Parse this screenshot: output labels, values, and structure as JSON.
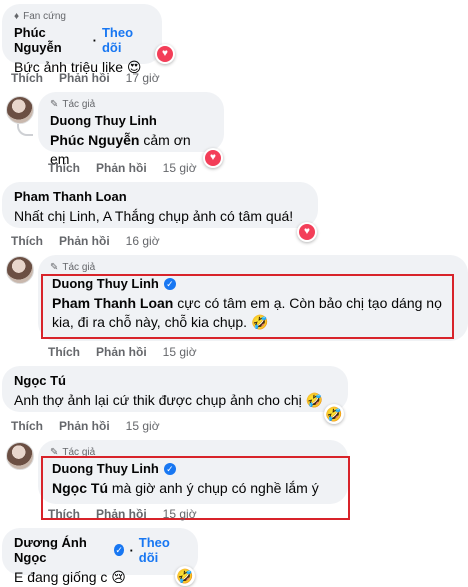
{
  "comments": [
    {
      "badge": "Fan cứng",
      "name": "Phúc Nguyễn",
      "follow": "Theo dõi",
      "text": "Bức ảnh triệu like",
      "emoji": "😍",
      "like": "Thích",
      "reply": "Phản hồi",
      "time": "17 giờ"
    },
    {
      "badge": "Tác giả",
      "name": "Duong Thuy Linh",
      "mention": "Phúc Nguyễn",
      "text": " cảm ơn em",
      "like": "Thích",
      "reply": "Phản hồi",
      "time": "15 giờ"
    },
    {
      "name": "Pham Thanh Loan",
      "text": "Nhất chị Linh, A Thắng chụp ảnh có tâm quá!",
      "like": "Thích",
      "reply": "Phản hồi",
      "time": "16 giờ"
    },
    {
      "badge": "Tác giả",
      "name": "Duong Thuy Linh",
      "mention": "Pham Thanh Loan",
      "text_line1": " cực có tâm em ạ. Còn bảo chị tạo dáng nọ",
      "text_line2": "kia, đi ra chỗ này, chỗ kia chụp.",
      "emoji": "🤣",
      "like": "Thích",
      "reply": "Phản hồi",
      "time": "15 giờ"
    },
    {
      "name": "Ngọc Tú",
      "text": "Anh thợ ảnh lại cứ thik được chụp ảnh cho chị",
      "emoji": "🤣",
      "like": "Thích",
      "reply": "Phản hồi",
      "time": "15 giờ"
    },
    {
      "badge": "Tác giả",
      "name": "Duong Thuy Linh",
      "mention": "Ngọc Tú",
      "text": " mà giờ anh ý chụp có nghề lắm ý",
      "like": "Thích",
      "reply": "Phản hồi",
      "time": "15 giờ"
    },
    {
      "name": "Dương Ánh Ngọc",
      "follow": "Theo dõi",
      "text": "E đang giống c",
      "emoji": "😢"
    }
  ],
  "colors": {
    "highlight": "#d8232a",
    "link": "#1877f2",
    "heart": "#f33e58"
  }
}
